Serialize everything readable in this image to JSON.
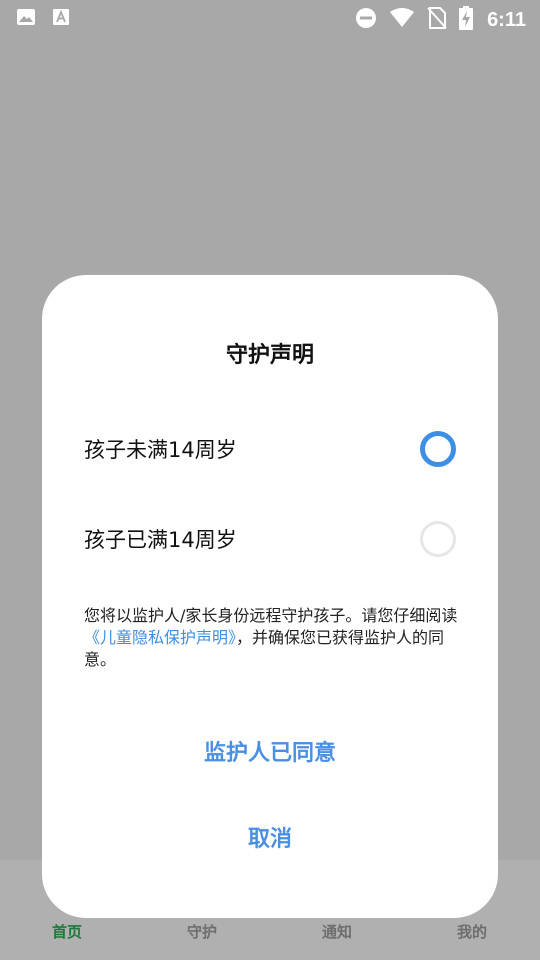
{
  "status_bar": {
    "time": "6:11",
    "icons": [
      "image-icon",
      "font-icon",
      "do-not-disturb-icon",
      "wifi-icon",
      "no-sim-icon",
      "battery-charging-icon"
    ]
  },
  "bottom_nav": {
    "items": [
      {
        "label": "首页",
        "active": true
      },
      {
        "label": "守护",
        "active": false
      },
      {
        "label": "通知",
        "active": false
      },
      {
        "label": "我的",
        "active": false
      }
    ]
  },
  "dialog": {
    "title": "守护声明",
    "options": [
      {
        "label": "孩子未满14周岁",
        "selected": true
      },
      {
        "label": "孩子已满14周岁",
        "selected": false
      }
    ],
    "notice_before": "您将以监护人/家长身份远程守护孩子。请您仔细阅读",
    "notice_link": "《儿童隐私保护声明》",
    "notice_after": "，并确保您已获得监护人的同意。",
    "confirm_label": "监护人已同意",
    "cancel_label": "取消"
  },
  "colors": {
    "accent": "#3d8fe6",
    "button_text": "#4a90e2",
    "overlay": "#a8a8a8",
    "nav_active": "#1e7a3a"
  }
}
